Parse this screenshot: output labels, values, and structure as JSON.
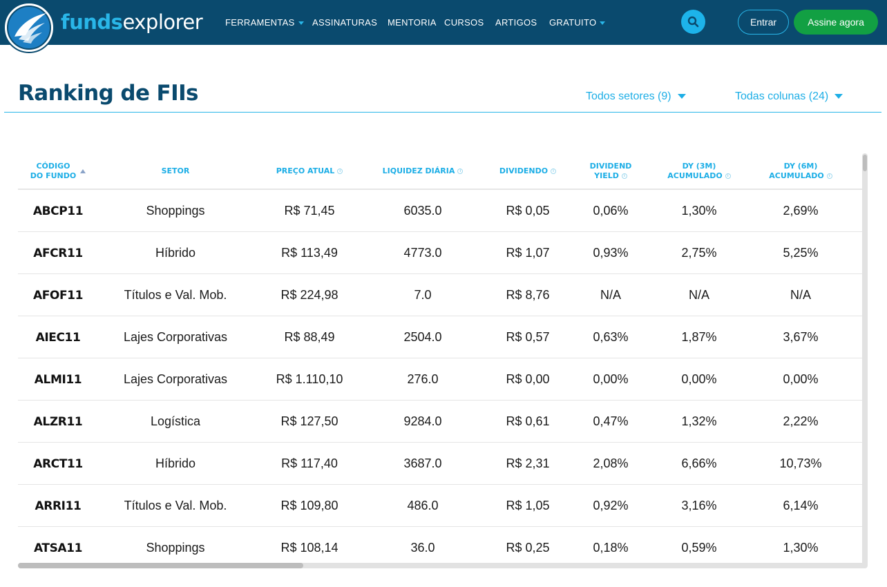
{
  "brand": {
    "part1": "funds",
    "part2": "explorer",
    "logo_icon": "wings-logo-icon"
  },
  "nav": {
    "items": [
      {
        "label": "FERRAMENTAS",
        "dropdown": true
      },
      {
        "label": "ASSINATURAS",
        "dropdown": false
      },
      {
        "label": "MENTORIA",
        "dropdown": false
      },
      {
        "label": "CURSOS",
        "dropdown": false
      },
      {
        "label": "ARTIGOS",
        "dropdown": false
      },
      {
        "label": "GRATUITO",
        "dropdown": true
      }
    ],
    "search_icon": "search-icon",
    "login_label": "Entrar",
    "subscribe_label": "Assine agora"
  },
  "page": {
    "title": "Ranking de FIIs",
    "filter_sectors": "Todos setores (9)",
    "filter_columns": "Todas colunas (24)"
  },
  "table": {
    "columns": [
      {
        "lines": [
          "CÓDIGO",
          "DO FUNDO"
        ],
        "info": false,
        "sort": "asc"
      },
      {
        "lines": [
          "SETOR"
        ],
        "info": false
      },
      {
        "lines": [
          "PREÇO ATUAL"
        ],
        "info": true
      },
      {
        "lines": [
          "LIQUIDEZ DIÁRIA"
        ],
        "info": true
      },
      {
        "lines": [
          "DIVIDENDO"
        ],
        "info": true
      },
      {
        "lines": [
          "DIVIDEND",
          "YIELD"
        ],
        "info": true
      },
      {
        "lines": [
          "DY (3M)",
          "ACUMULADO"
        ],
        "info": true
      },
      {
        "lines": [
          "DY (6M)",
          "ACUMULADO"
        ],
        "info": true
      }
    ],
    "rows": [
      [
        "ABCP11",
        "Shoppings",
        "R$ 71,45",
        "6035.0",
        "R$ 0,05",
        "0,06%",
        "1,30%",
        "2,69%"
      ],
      [
        "AFCR11",
        "Híbrido",
        "R$ 113,49",
        "4773.0",
        "R$ 1,07",
        "0,93%",
        "2,75%",
        "5,25%"
      ],
      [
        "AFOF11",
        "Títulos e Val. Mob.",
        "R$ 224,98",
        "7.0",
        "R$ 8,76",
        "N/A",
        "N/A",
        "N/A"
      ],
      [
        "AIEC11",
        "Lajes Corporativas",
        "R$ 88,49",
        "2504.0",
        "R$ 0,57",
        "0,63%",
        "1,87%",
        "3,67%"
      ],
      [
        "ALMI11",
        "Lajes Corporativas",
        "R$ 1.110,10",
        "276.0",
        "R$ 0,00",
        "0,00%",
        "0,00%",
        "0,00%"
      ],
      [
        "ALZR11",
        "Logística",
        "R$ 127,50",
        "9284.0",
        "R$ 0,61",
        "0,47%",
        "1,32%",
        "2,22%"
      ],
      [
        "ARCT11",
        "Híbrido",
        "R$ 117,40",
        "3687.0",
        "R$ 2,31",
        "2,08%",
        "6,66%",
        "10,73%"
      ],
      [
        "ARRI11",
        "Títulos e Val. Mob.",
        "R$ 109,80",
        "486.0",
        "R$ 1,05",
        "0,92%",
        "3,16%",
        "6,14%"
      ],
      [
        "ATSA11",
        "Shoppings",
        "R$ 108,14",
        "36.0",
        "R$ 0,25",
        "0,18%",
        "0,59%",
        "1,30%"
      ]
    ]
  },
  "colors": {
    "navbar": "#0a4a6e",
    "accent": "#1daee6",
    "subscribe": "#12a043"
  }
}
